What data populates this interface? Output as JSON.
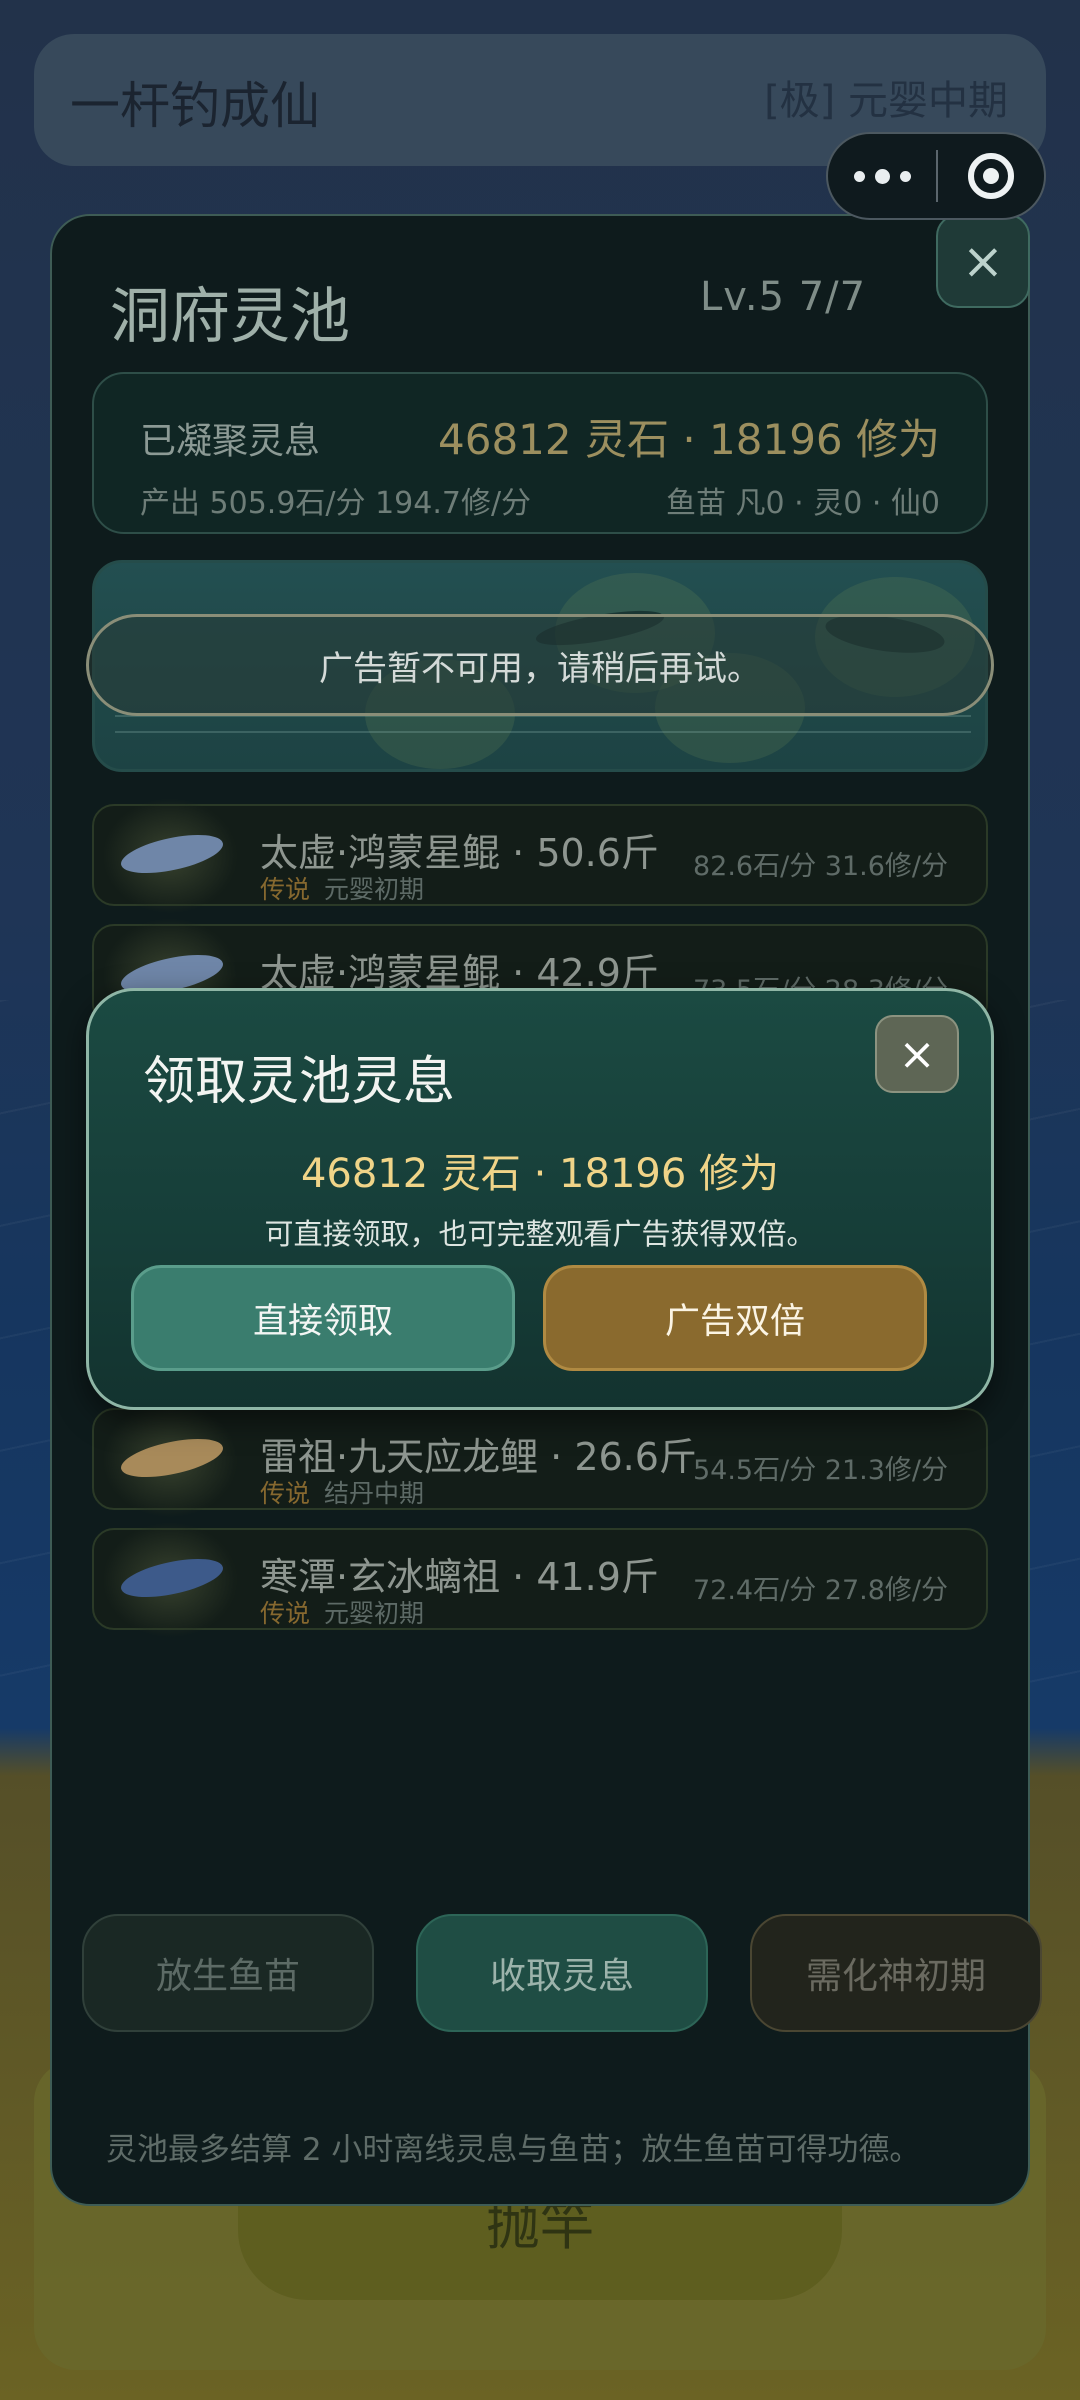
{
  "header": {
    "title": "一杆钓成仙",
    "rank": "[极] 元婴中期"
  },
  "capsule": {
    "more_icon": "more-dots-icon",
    "close_icon": "target-close-icon"
  },
  "panel": {
    "title": "洞府灵池",
    "level": "Lv.5  7/7",
    "close_label": "×",
    "stats": {
      "label": "已凝聚灵息",
      "amount": "46812 灵石 · 18196 修为",
      "output": "产出 505.9石/分  194.7修/分",
      "seedlings": "鱼苗 凡0 · 灵0 · 仙0"
    },
    "toast": "广告暂不可用，请稍后再试。",
    "fish": [
      {
        "name": "太虚·鸿蒙星鲲 · 50.6斤",
        "rarity": "传说",
        "realm": "元婴初期",
        "rate": "82.6石/分 31.6修/分",
        "color": "#6f86a8"
      },
      {
        "name": "太虚·鸿蒙星鲲 · 42.9斤",
        "rarity": "",
        "realm": "",
        "rate": "73.5石/分 28.3修/分",
        "color": "#6f86a8"
      },
      {
        "name": "雷祖·九天应龙鲤 · 26.6斤",
        "rarity": "传说",
        "realm": "结丹中期",
        "rate": "54.5石/分 21.3修/分",
        "color": "#a88a5a"
      },
      {
        "name": "寒潭·玄冰螭祖 · 41.9斤",
        "rarity": "传说",
        "realm": "元婴初期",
        "rate": "72.4石/分 27.8修/分",
        "color": "#3d5a8a"
      }
    ],
    "buttons": {
      "release": "放生鱼苗",
      "collect": "收取灵息",
      "upgrade": "需化神初期"
    },
    "footnote": "灵池最多结算 2 小时离线灵息与鱼苗；放生鱼苗可得功德。"
  },
  "background": {
    "cast_label": "抛竿"
  },
  "modal": {
    "title": "领取灵池灵息",
    "close_label": "×",
    "reward": "46812 灵石 · 18196 修为",
    "description": "可直接领取，也可完整观看广告获得双倍。",
    "direct_button": "直接领取",
    "ad_button": "广告双倍"
  }
}
